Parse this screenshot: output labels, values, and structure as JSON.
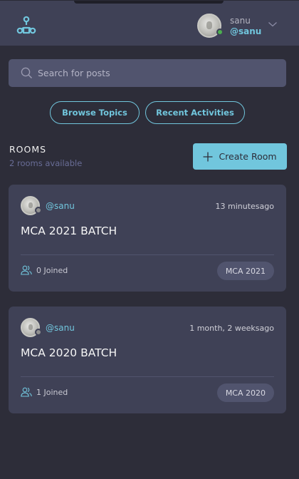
{
  "header": {
    "user_name": "sanu",
    "user_handle": "@sanu",
    "status_color": "#4caf50"
  },
  "search": {
    "placeholder": "Search for posts"
  },
  "nav": {
    "browse_topics": "Browse Topics",
    "recent_activities": "Recent Activities"
  },
  "rooms": {
    "title": "ROOMS",
    "count_text": "2 rooms available",
    "create_label": "Create Room",
    "items": [
      {
        "host": "@sanu",
        "time": "13 minutesago",
        "name": "MCA 2021 BATCH",
        "joined": "0 Joined",
        "topic": "MCA 2021"
      },
      {
        "host": "@sanu",
        "time": "1 month, 2 weeksago",
        "name": "MCA 2020 BATCH",
        "joined": "1 Joined",
        "topic": "MCA 2020"
      }
    ]
  },
  "colors": {
    "accent": "#71c6dd",
    "background": "#2d2d39",
    "card": "#3f4156",
    "muted": "#696d97"
  }
}
